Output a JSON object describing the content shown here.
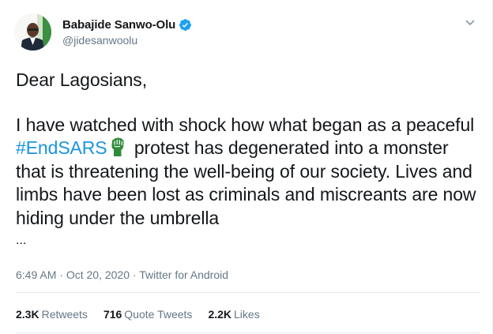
{
  "author": {
    "name": "Babajide Sanwo-Olu",
    "handle": "@jidesanwoolu",
    "avatar_icon": "profile-photo",
    "verified_icon": "verified-badge-icon"
  },
  "tweet": {
    "greeting": "Dear Lagosians,",
    "text_before_hashtag": "I have watched with shock how what began as a peaceful ",
    "hashtag": "#EndSARS",
    "hashtag_emoji_icon": "green-fist-icon",
    "text_after_hashtag": " protest has degenerated into a monster that is threatening the well-being of our society. Lives and limbs have been lost as criminals and miscreants are now hiding under the umbrella",
    "ellipsis": "..."
  },
  "meta": {
    "time": "6:49 AM",
    "separator1": " · ",
    "date": "Oct 20, 2020",
    "separator2": " · ",
    "source": "Twitter for Android"
  },
  "stats": {
    "retweets_count": "2.3K",
    "retweets_label": "Retweets",
    "quotes_count": "716",
    "quotes_label": "Quote Tweets",
    "likes_count": "2.2K",
    "likes_label": "Likes"
  },
  "colors": {
    "link": "#1b95e0",
    "secondary_text": "#657786",
    "primary_text": "#14171a",
    "verified": "#1da1f2",
    "fist": "#2e8b3a"
  }
}
